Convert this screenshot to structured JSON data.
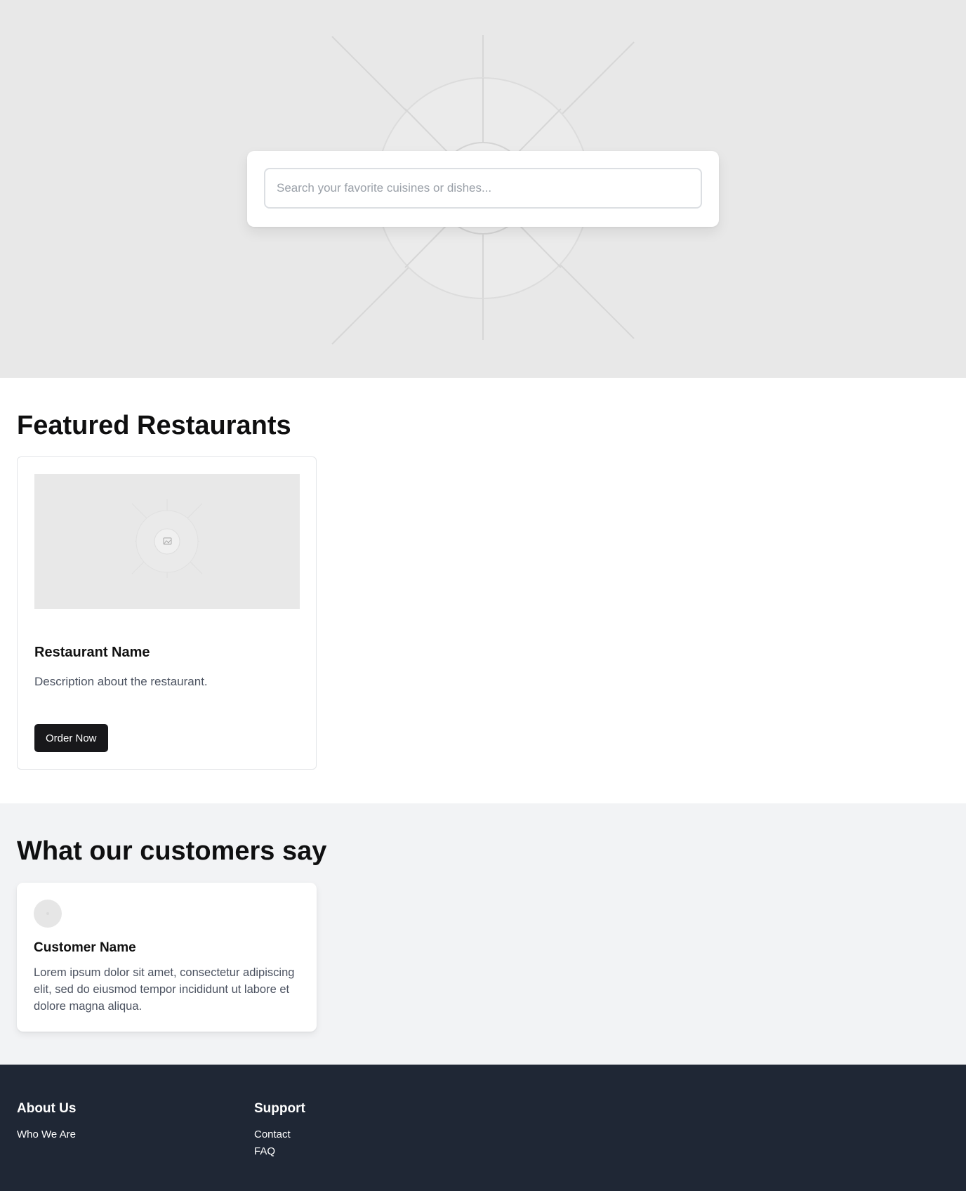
{
  "hero": {
    "search": {
      "placeholder": "Search your favorite cuisines or dishes..."
    },
    "background_icon": "image-placeholder-icon"
  },
  "featured": {
    "title": "Featured Restaurants",
    "restaurants": [
      {
        "image_icon": "image-placeholder-icon",
        "name": "Restaurant Name",
        "description": "Description about the restaurant.",
        "cta_label": "Order Now"
      }
    ]
  },
  "testimonials": {
    "title": "What our customers say",
    "items": [
      {
        "avatar_icon": "avatar-placeholder-icon",
        "name": "Customer Name",
        "text": "Lorem ipsum dolor sit amet, consectetur adipiscing elit, sed do eiusmod tempor incididunt ut labore et dolore magna aliqua."
      }
    ]
  },
  "footer": {
    "columns": [
      {
        "heading": "About Us",
        "links": [
          "Who We Are"
        ]
      },
      {
        "heading": "Support",
        "links": [
          "Contact",
          "FAQ"
        ]
      }
    ]
  },
  "colors": {
    "hero_bg": "#e8e8e8",
    "button_bg": "#18181b",
    "testimonials_bg": "#f2f3f5",
    "footer_bg": "#1f2735"
  }
}
